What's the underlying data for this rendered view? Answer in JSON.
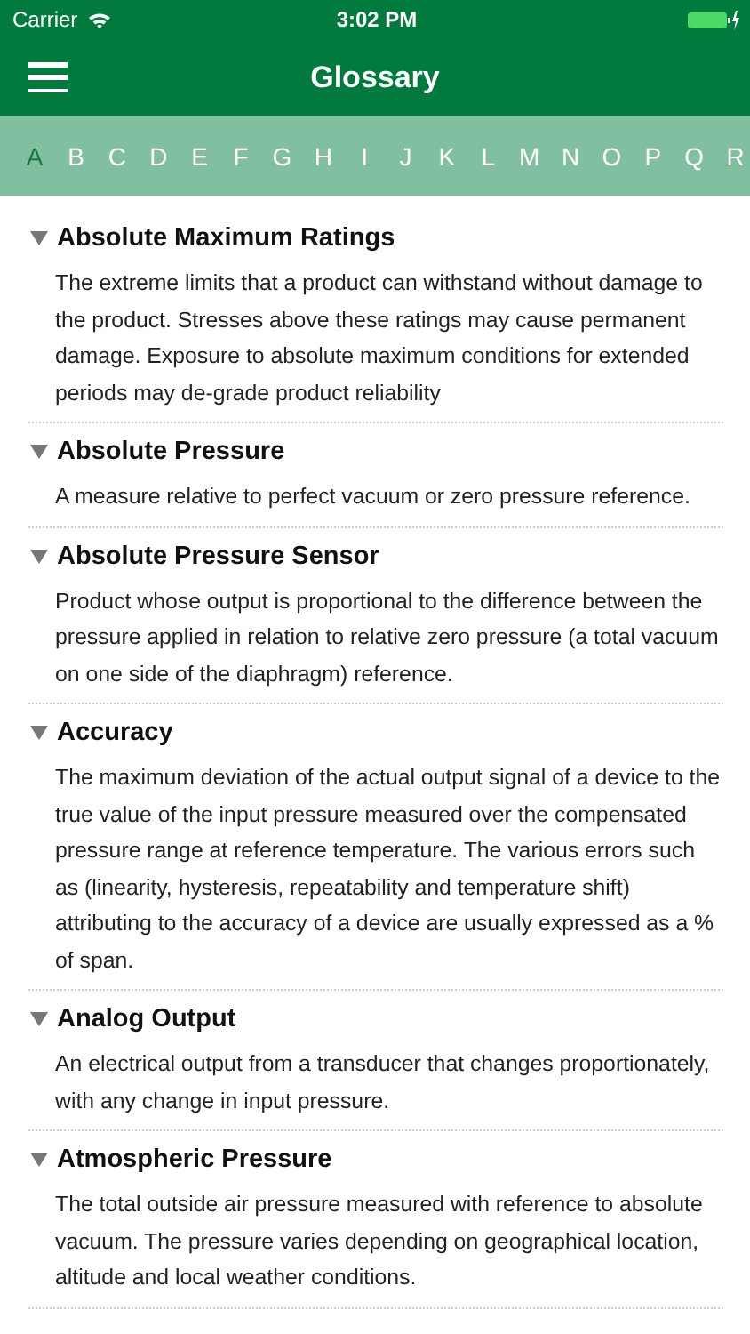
{
  "status_bar": {
    "carrier": "Carrier",
    "time": "3:02 PM"
  },
  "nav_bar": {
    "title": "Glossary"
  },
  "letters": [
    {
      "label": "A",
      "selected": true
    },
    {
      "label": "B",
      "selected": false
    },
    {
      "label": "C",
      "selected": false
    },
    {
      "label": "D",
      "selected": false
    },
    {
      "label": "E",
      "selected": false
    },
    {
      "label": "F",
      "selected": false
    },
    {
      "label": "G",
      "selected": false
    },
    {
      "label": "H",
      "selected": false
    },
    {
      "label": "I",
      "selected": false
    },
    {
      "label": "J",
      "selected": false
    },
    {
      "label": "K",
      "selected": false
    },
    {
      "label": "L",
      "selected": false
    },
    {
      "label": "M",
      "selected": false
    },
    {
      "label": "N",
      "selected": false
    },
    {
      "label": "O",
      "selected": false
    },
    {
      "label": "P",
      "selected": false
    },
    {
      "label": "Q",
      "selected": false
    },
    {
      "label": "R",
      "selected": false
    }
  ],
  "entries": [
    {
      "term": "Absolute Maximum Ratings",
      "expanded": true,
      "definition": "The extreme limits that a product can withstand without damage to the product. Stresses above these ratings may cause permanent damage. Exposure to absolute maximum conditions for extended periods may de-grade product reliability"
    },
    {
      "term": "Absolute Pressure",
      "expanded": true,
      "definition": "A measure relative to perfect vacuum or zero pressure reference."
    },
    {
      "term": "Absolute Pressure Sensor",
      "expanded": true,
      "definition": "Product whose output is proportional to the difference between the pressure applied in relation to relative zero pressure (a total vacuum on one side of the diaphragm) reference."
    },
    {
      "term": "Accuracy",
      "expanded": true,
      "definition": "The maximum deviation of the actual output signal of a device to the true value of the input pressure measured over the compensated pressure range at reference temperature. The various errors such as (linearity, hysteresis, repeatability and temperature shift) attributing to the accuracy of a device are usually expressed as a % of span."
    },
    {
      "term": "Analog Output",
      "expanded": true,
      "definition": "An electrical output from a transducer that changes proportionately, with any change in input pressure."
    },
    {
      "term": "Atmospheric Pressure",
      "expanded": true,
      "definition": "The total outside air pressure measured with reference to absolute vacuum. The pressure varies depending on geographical location, altitude and local weather conditions."
    }
  ]
}
